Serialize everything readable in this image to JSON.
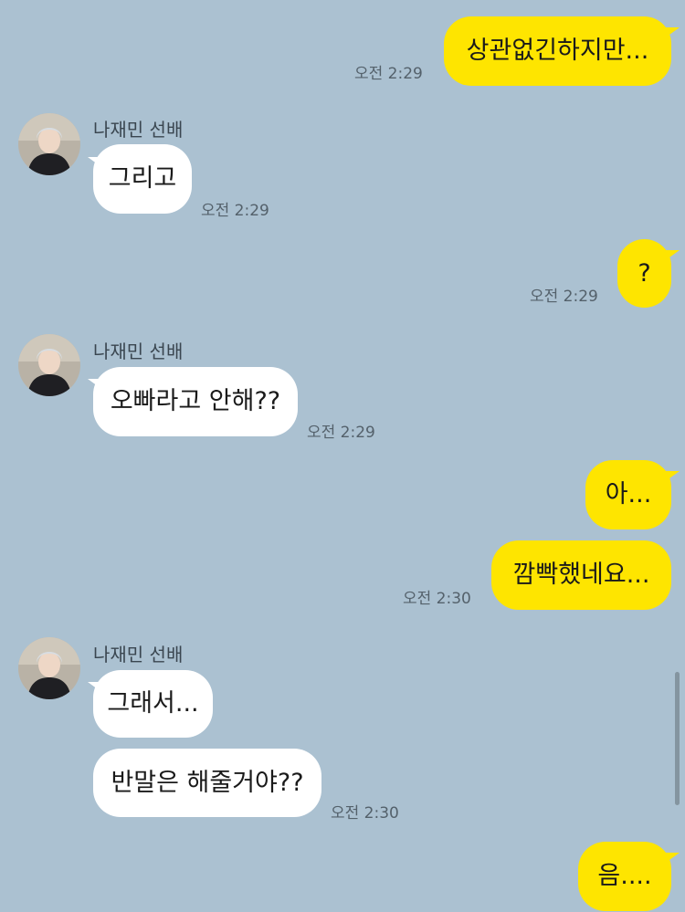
{
  "chat": {
    "sender_name": "나재민 선배",
    "messages": [
      {
        "from": "me",
        "text": "상관없긴하지만...",
        "time": "오전 2:29"
      },
      {
        "from": "them",
        "text": "그리고",
        "time": "오전 2:29"
      },
      {
        "from": "me",
        "text": "?",
        "time": "오전 2:29"
      },
      {
        "from": "them",
        "text": "오빠라고 안해??",
        "time": "오전 2:29"
      },
      {
        "from": "me",
        "text": "아..."
      },
      {
        "from": "me",
        "text": "깜빡했네요...",
        "time": "오전 2:30"
      },
      {
        "from": "them",
        "text": "그래서..."
      },
      {
        "from": "them",
        "text": "반말은 해줄거야??",
        "time": "오전 2:30"
      },
      {
        "from": "me",
        "text": "음...."
      }
    ]
  },
  "colors": {
    "background": "#abc1d1",
    "my_bubble": "#fee500",
    "their_bubble": "#ffffff",
    "timestamp": "#54616b"
  },
  "icons": {
    "avatar": "profile-photo"
  }
}
